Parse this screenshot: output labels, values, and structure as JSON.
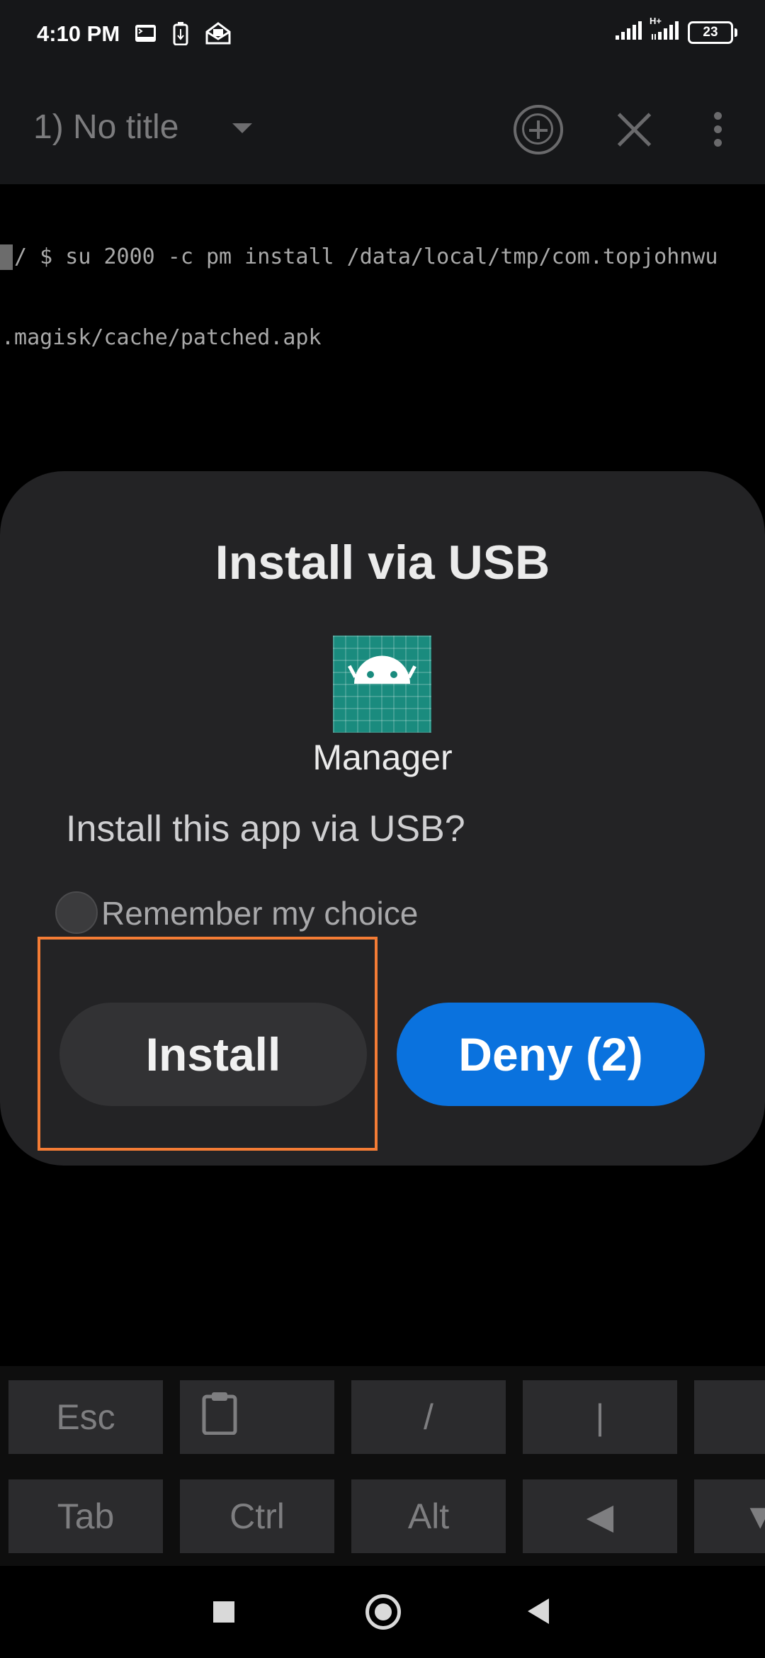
{
  "status_bar": {
    "time": "4:10 PM",
    "left_icons": [
      "terminal-notification-icon",
      "usb-debugging-icon",
      "mail-notification-icon"
    ],
    "network_label": "H+",
    "battery_level": "23"
  },
  "toolbar": {
    "session_title": "1) No title",
    "icons": [
      "dropdown-caret-icon",
      "add-session-icon",
      "close-icon",
      "overflow-menu-icon"
    ]
  },
  "terminal": {
    "lines": [
      ":/ $ su 2000 -c pm install /data/local/tmp/com.topjohnwu",
      ".magisk/cache/patched.apk"
    ]
  },
  "dialog": {
    "title": "Install via USB",
    "app_icon": "android-app-icon",
    "app_name": "Manager",
    "message": "Install this app via USB?",
    "remember_label": "Remember my choice",
    "remember_checked": false,
    "install_label": "Install",
    "deny_label": "Deny (2)",
    "colors": {
      "dialog_bg": "#232325",
      "deny_button": "#0a72de",
      "highlight": "#f47c35"
    }
  },
  "extra_keys": {
    "row1": [
      "Esc",
      "",
      "/",
      "|",
      "/"
    ],
    "row2": [
      "Tab",
      "Ctrl",
      "Alt",
      "◀",
      "▼"
    ],
    "row1_icon": "clipboard-icon"
  },
  "navigation": {
    "recents": "recents-icon",
    "home": "home-icon",
    "back": "back-icon"
  }
}
